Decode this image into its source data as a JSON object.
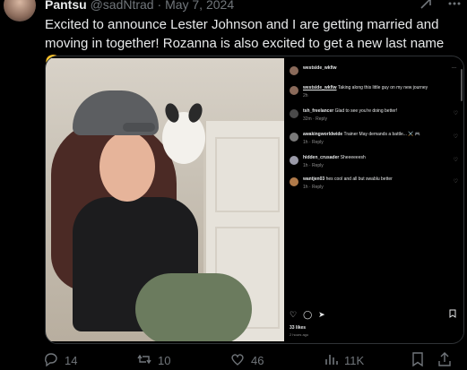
{
  "tweet": {
    "display_name": "Pantsu",
    "handle": "@sadNtrad",
    "separator": "·",
    "date": "May 7, 2024",
    "text": "Excited to announce Lester Johnson and I are getting married and moving in together! Rozanna is also excited to get a new last name 🤗"
  },
  "instagram": {
    "header_user": "westside_wkfiw",
    "comments": [
      {
        "user": "westside_wkfiw",
        "text": "Taking along this little guy on my new journey",
        "meta": "2h"
      },
      {
        "user": "tsh_freelancer",
        "text": "Glad to see you're doing better!",
        "meta": "32m · Reply"
      },
      {
        "user": "awakingworldwide",
        "text": "Trainer May demands a battle... ⚔️ 🎮",
        "meta": "1h · Reply"
      },
      {
        "user": "hidden_crusader",
        "text": "Sheeeeeesh",
        "meta": "1h · Reply"
      },
      {
        "user": "wantjen03",
        "text": "hes cool and all but swablu better",
        "meta": "1h · Reply"
      }
    ],
    "likes": "33 likes",
    "time_ago": "2 hours ago"
  },
  "stats": {
    "replies": "14",
    "retweets": "10",
    "likes": "46",
    "views": "11K"
  },
  "icons": {
    "grok": "grok-icon",
    "more": "more-icon",
    "reply": "reply-icon",
    "retweet": "retweet-icon",
    "like": "heart-icon",
    "views": "views-icon",
    "bookmark": "bookmark-icon",
    "share": "share-icon"
  }
}
